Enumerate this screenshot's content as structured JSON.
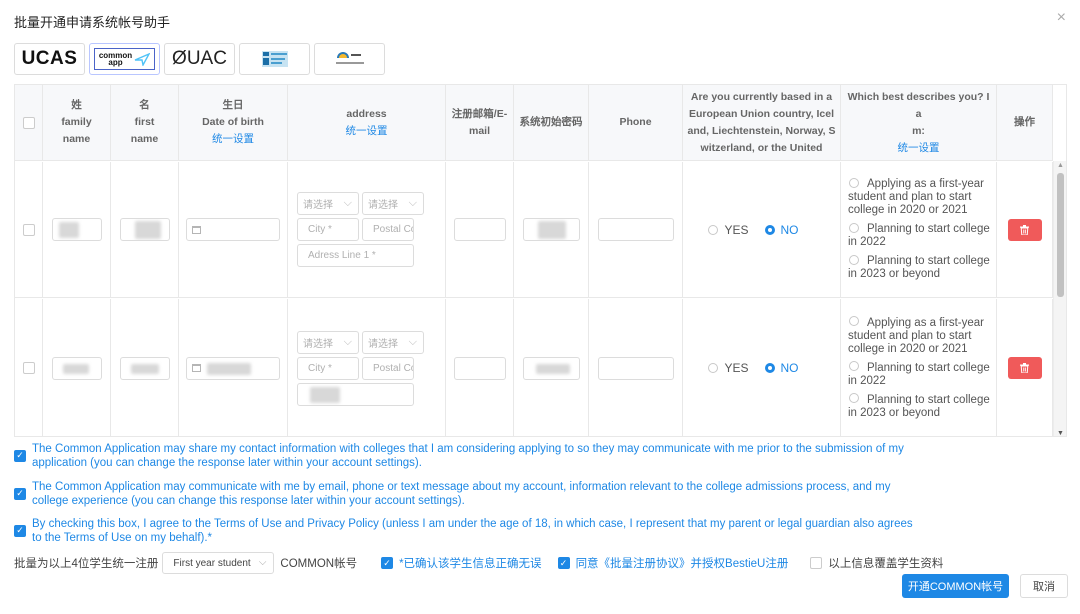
{
  "dialog": {
    "title": "批量开通申请系统帐号助手",
    "close_glyph": "×"
  },
  "tabs": [
    {
      "label": "UCAS",
      "active": false
    },
    {
      "label": "common app",
      "active": true
    },
    {
      "label": "ØUAC",
      "active": false
    },
    {
      "label": "",
      "active": false
    },
    {
      "label": "",
      "active": false
    }
  ],
  "table": {
    "headers": {
      "last_name": [
        "姓",
        "family",
        "name"
      ],
      "first_name": [
        "名",
        "first",
        "name"
      ],
      "dob": [
        "生日",
        "Date of birth"
      ],
      "dob_link": "统一设置",
      "address": "address",
      "address_link": "统一设置",
      "email": [
        "注册邮箱/E-",
        "mail"
      ],
      "password": "系统初始密码",
      "phone": "Phone",
      "eu": [
        "Are you currently based in a",
        "European Union country, Icel",
        "and, Liechtenstein, Norway, S",
        "witzerland, or the United"
      ],
      "describes": [
        "Which best describes you? I a",
        "m:"
      ],
      "describes_link": "统一设置",
      "action": "操作"
    },
    "placeholders": {
      "select": "请选择",
      "city": "City *",
      "postal": "Postal Code",
      "address_line": "Adress Line 1 *"
    },
    "radio_yes": "YES",
    "radio_no": "NO",
    "describe_options": [
      "Applying as a first-year student and plan to start college in 2020 or 2021",
      "Planning to start college in 2022",
      "Planning to start college in 2023 or beyond"
    ],
    "rows": [
      {
        "eu_answer": "NO"
      },
      {
        "eu_answer": "NO"
      }
    ]
  },
  "consents": [
    {
      "checked": true,
      "text": "The Common Application may share my contact information with colleges that I am considering applying to so they may communicate with me prior to the submission of my application (you can change the response later within your account settings)."
    },
    {
      "checked": true,
      "text": "The Common Application may communicate with me by email, phone or text message about my account, information relevant to the college admissions process, and my college experience (you can change this response later within your account settings)."
    },
    {
      "checked": true,
      "text": "By checking this box, I agree to the Terms of Use and Privacy Policy (unless I am under the age of 18, in which case, I represent that my parent or legal guardian also agrees to the Terms of Use on my behalf).*"
    }
  ],
  "bottom": {
    "prefix": "批量为以上4位学生统一注册",
    "select_value": "First year student",
    "suffix": "COMMON帐号",
    "confirm_label": "*已确认该学生信息正确无误",
    "agree_label": "同意《批量注册协议》并授权BestieU注册",
    "cover_label": "以上信息覆盖学生资料",
    "submit": "开通COMMON帐号",
    "cancel": "取消"
  },
  "colors": {
    "accent": "#1e88e5",
    "danger": "#f05a5a"
  }
}
